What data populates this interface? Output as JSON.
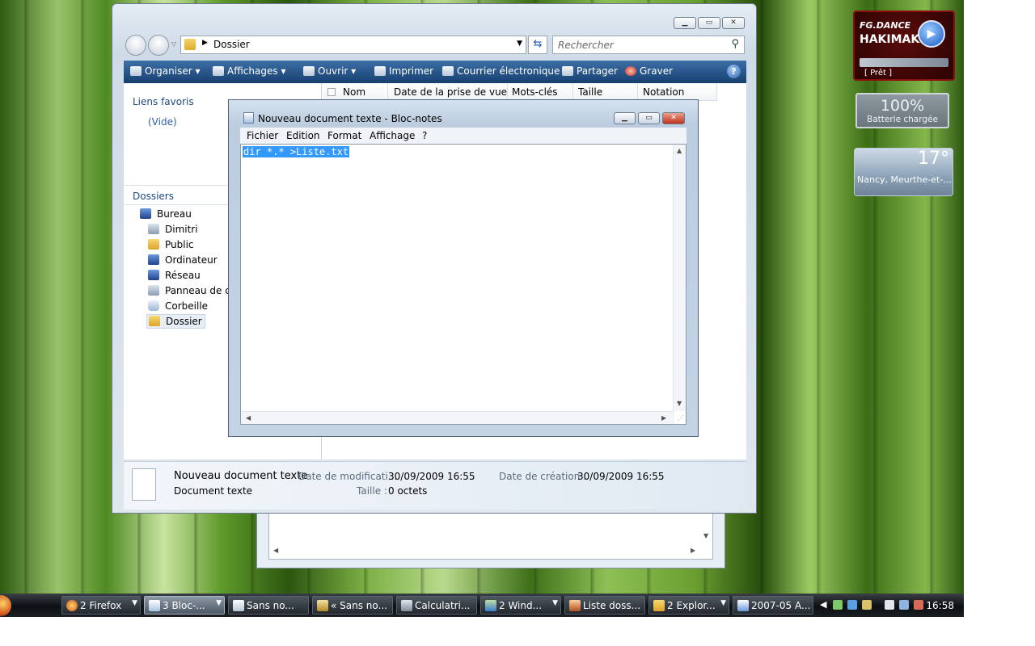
{
  "explorer": {
    "address_folder": "Dossier",
    "search_placeholder": "Rechercher",
    "toolbar": {
      "organize": "Organiser",
      "views": "Affichages",
      "open": "Ouvrir",
      "print": "Imprimer",
      "email": "Courrier électronique",
      "share": "Partager",
      "burn": "Graver",
      "help": "?"
    },
    "favorites_label": "Liens favoris",
    "favorites_empty": "(Vide)",
    "folders_label": "Dossiers",
    "tree": [
      "Bureau",
      "Dimitri",
      "Public",
      "Ordinateur",
      "Réseau",
      "Panneau de co",
      "Corbeille",
      "Dossier"
    ],
    "columns": [
      "Nom",
      "Date de la prise de vue",
      "Mots-clés",
      "Taille",
      "Notation"
    ],
    "details": {
      "name": "Nouveau document texte",
      "type": "Document texte",
      "modified_label": "Date de modificati...",
      "modified_value": "30/09/2009 16:55",
      "created_label": "Date de création :",
      "created_value": "30/09/2009 16:55",
      "size_label": "Taille :",
      "size_value": "0 octets"
    }
  },
  "notepad": {
    "title": "Nouveau document texte - Bloc-notes",
    "menus": [
      "Fichier",
      "Edition",
      "Format",
      "Affichage",
      "?"
    ],
    "content": "dir *.* >Liste.txt"
  },
  "gadgets": {
    "radio_line1": "FG.DANCE",
    "radio_line2": "HAKIMAKLI",
    "radio_status": "[ Prêt ]",
    "battery_percent": "100%",
    "battery_status": "Batterie chargée",
    "weather_temp": "17°",
    "weather_location": "Nancy, Meurthe-et-..."
  },
  "taskbar": {
    "tasks": [
      "2 Firefox",
      "3 Bloc-...",
      "Sans no...",
      "« Sans no...",
      "Calculatri...",
      "2 Wind...",
      "Liste doss...",
      "2 Explor...",
      "2007-05 A..."
    ],
    "clock": "16:58"
  },
  "colors": {
    "toolbar": "#163f6e",
    "selection": "#3399ff",
    "close_button": "#c1311c"
  }
}
